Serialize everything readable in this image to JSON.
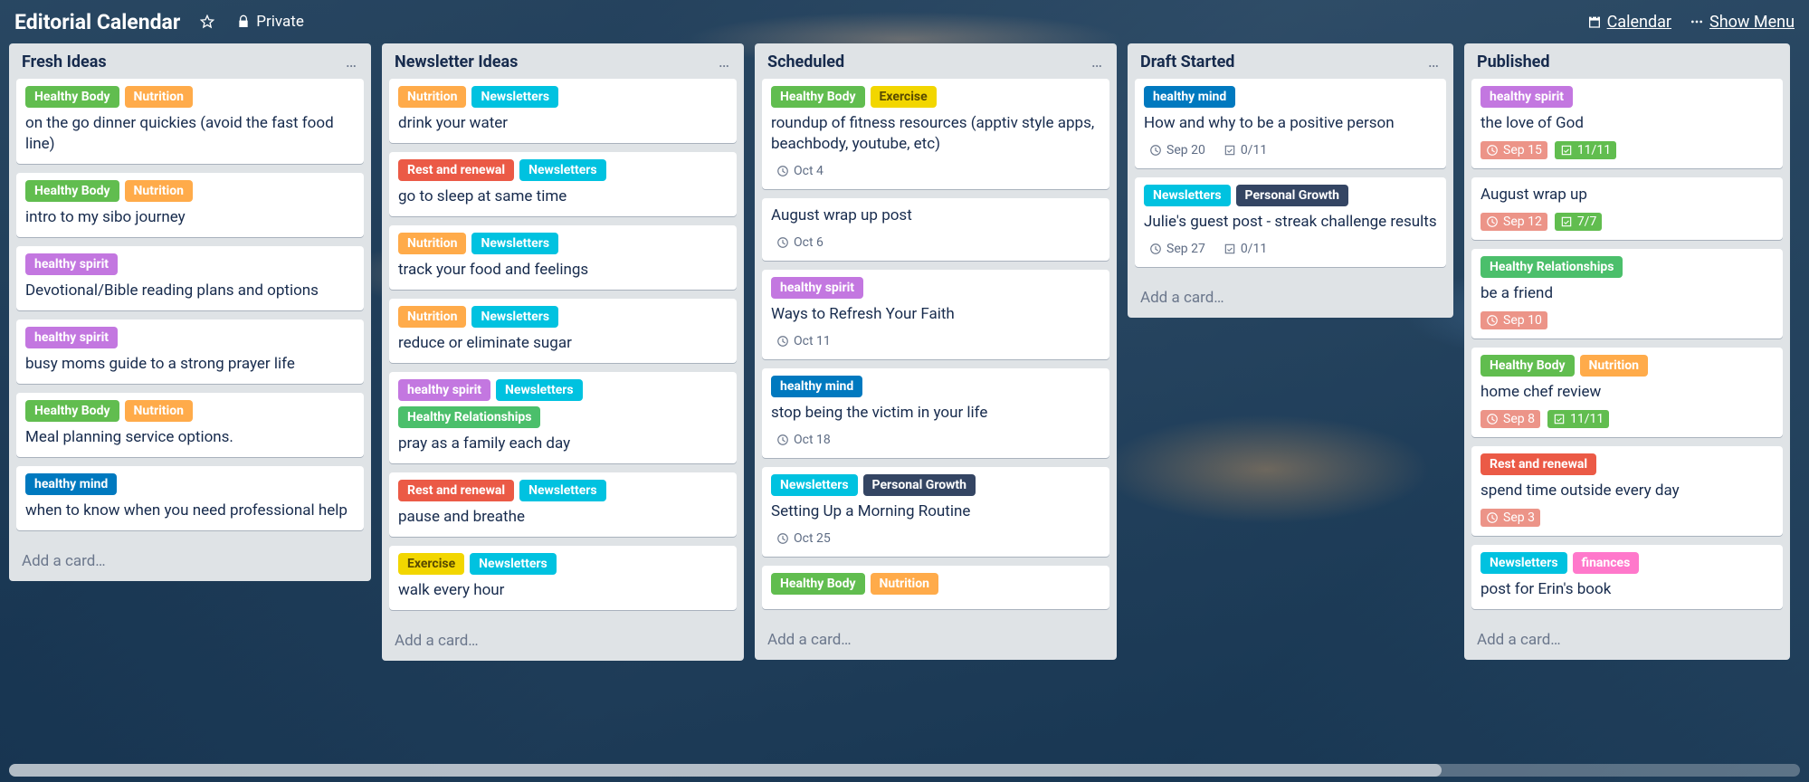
{
  "header": {
    "title": "Editorial Calendar",
    "privacy": "Private",
    "calendar_link": "Calendar",
    "show_menu": "Show Menu"
  },
  "label_colors": {
    "Healthy Body": "c-green",
    "Nutrition": "c-orange",
    "healthy spirit": "c-purple",
    "healthy mind": "c-blue",
    "Rest and renewal": "c-red",
    "Newsletters": "c-sky",
    "Healthy Relationships": "c-teal",
    "Exercise": "c-yellow",
    "Personal Growth": "c-black",
    "finances": "c-pink"
  },
  "add_card_text": "Add a card…",
  "lists": [
    {
      "name": "Fresh Ideas",
      "show_menu": true,
      "cards": [
        {
          "labels": [
            "Healthy Body",
            "Nutrition"
          ],
          "title": "on the go dinner quickies (avoid the fast food line)"
        },
        {
          "labels": [
            "Healthy Body",
            "Nutrition"
          ],
          "title": "intro to my sibo journey"
        },
        {
          "labels": [
            "healthy spirit"
          ],
          "title": "Devotional/Bible reading plans and options"
        },
        {
          "labels": [
            "healthy spirit"
          ],
          "title": "busy moms guide to a strong prayer life"
        },
        {
          "labels": [
            "Healthy Body",
            "Nutrition"
          ],
          "title": "Meal planning service options."
        },
        {
          "labels": [
            "healthy mind"
          ],
          "title": "when to know when you need professional help"
        }
      ]
    },
    {
      "name": "Newsletter Ideas",
      "show_menu": true,
      "cards": [
        {
          "labels": [
            "Nutrition",
            "Newsletters"
          ],
          "title": "drink your water"
        },
        {
          "labels": [
            "Rest and renewal",
            "Newsletters"
          ],
          "title": "go to sleep at same time"
        },
        {
          "labels": [
            "Nutrition",
            "Newsletters"
          ],
          "title": "track your food and feelings"
        },
        {
          "labels": [
            "Nutrition",
            "Newsletters"
          ],
          "title": "reduce or eliminate sugar"
        },
        {
          "labels": [
            "healthy spirit",
            "Newsletters",
            "Healthy Relationships"
          ],
          "title": "pray as a family each day"
        },
        {
          "labels": [
            "Rest and renewal",
            "Newsletters"
          ],
          "title": "pause and breathe"
        },
        {
          "labels": [
            "Exercise",
            "Newsletters"
          ],
          "title": "walk every hour"
        }
      ]
    },
    {
      "name": "Scheduled",
      "show_menu": true,
      "cards": [
        {
          "labels": [
            "Healthy Body",
            "Exercise"
          ],
          "title": "roundup of fitness resources (apptiv style apps, beachbody, youtube, etc)",
          "due": "Oct 4"
        },
        {
          "labels": [],
          "title": "August wrap up post",
          "due": "Oct 6"
        },
        {
          "labels": [
            "healthy spirit"
          ],
          "title": "Ways to Refresh Your Faith",
          "due": "Oct 11"
        },
        {
          "labels": [
            "healthy mind"
          ],
          "title": "stop being the victim in your life",
          "due": "Oct 18"
        },
        {
          "labels": [
            "Newsletters",
            "Personal Growth"
          ],
          "title": "Setting Up a Morning Routine",
          "due": "Oct 25"
        },
        {
          "labels": [
            "Healthy Body",
            "Nutrition"
          ],
          "title": ""
        }
      ]
    },
    {
      "name": "Draft Started",
      "show_menu": true,
      "narrow": true,
      "cards": [
        {
          "labels": [
            "healthy mind"
          ],
          "title": "How and why to be a positive person",
          "due": "Sep 20",
          "checklist": "0/11"
        },
        {
          "labels": [
            "Newsletters",
            "Personal Growth"
          ],
          "title": "Julie's guest post - streak challenge results",
          "due": "Sep 27",
          "checklist": "0/11"
        }
      ]
    },
    {
      "name": "Published",
      "show_menu": false,
      "narrow": true,
      "cards": [
        {
          "labels": [
            "healthy spirit"
          ],
          "title": "the love of God",
          "due": "Sep 15",
          "due_past": true,
          "checklist": "11/11",
          "check_done": true
        },
        {
          "labels": [],
          "title": "August wrap up",
          "due": "Sep 12",
          "due_past": true,
          "checklist": "7/7",
          "check_done": true
        },
        {
          "labels": [
            "Healthy Relationships"
          ],
          "title": "be a friend",
          "due": "Sep 10",
          "due_past": true
        },
        {
          "labels": [
            "Healthy Body",
            "Nutrition"
          ],
          "title": "home chef review",
          "due": "Sep 8",
          "due_past": true,
          "checklist": "11/11",
          "check_done": true
        },
        {
          "labels": [
            "Rest and renewal"
          ],
          "title": "spend time outside every day",
          "due": "Sep 3",
          "due_past": true
        },
        {
          "labels": [
            "Newsletters",
            "finances"
          ],
          "title": "post for Erin's book"
        }
      ]
    }
  ]
}
